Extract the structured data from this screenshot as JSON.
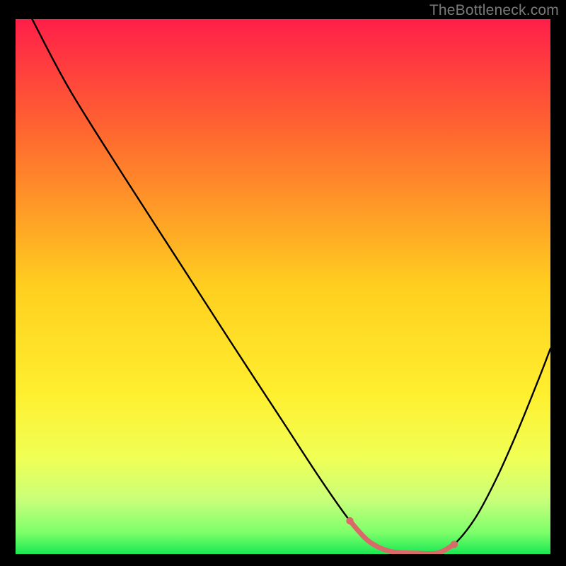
{
  "watermark": "TheBottleneck.com",
  "chart_data": {
    "type": "line",
    "title": "",
    "xlabel": "",
    "ylabel": "",
    "xlim": [
      0,
      100
    ],
    "ylim": [
      0,
      100
    ],
    "grid": false,
    "legend": false,
    "background_gradient": {
      "stops": [
        {
          "pos": 0.0,
          "color": "#ff1f49"
        },
        {
          "pos": 0.5,
          "color": "#ffcf1f"
        },
        {
          "pos": 0.78,
          "color": "#f4ff40"
        },
        {
          "pos": 0.9,
          "color": "#c8ff7a"
        },
        {
          "pos": 1.0,
          "color": "#19e853"
        }
      ]
    },
    "series": [
      {
        "name": "bottleneck-curve",
        "color": "#000000",
        "x": [
          3.1,
          10,
          20,
          30,
          40,
          50,
          57,
          62.5,
          66,
          70,
          75,
          79,
          82,
          86,
          90,
          94,
          98,
          100
        ],
        "values": [
          100,
          87,
          71,
          55.5,
          40,
          24.7,
          14,
          6.2,
          2.4,
          0.5,
          0.15,
          0.2,
          1.8,
          6.8,
          14.3,
          23.3,
          33.2,
          38.4
        ]
      }
    ],
    "highlight_segment": {
      "name": "flat-zone",
      "color": "#d86a6a",
      "x": [
        62.5,
        66,
        70,
        75,
        79,
        82
      ],
      "values": [
        6.2,
        2.4,
        0.5,
        0.15,
        0.2,
        1.8
      ],
      "endpoints": [
        [
          62.5,
          6.2
        ],
        [
          82,
          1.8
        ]
      ]
    }
  }
}
